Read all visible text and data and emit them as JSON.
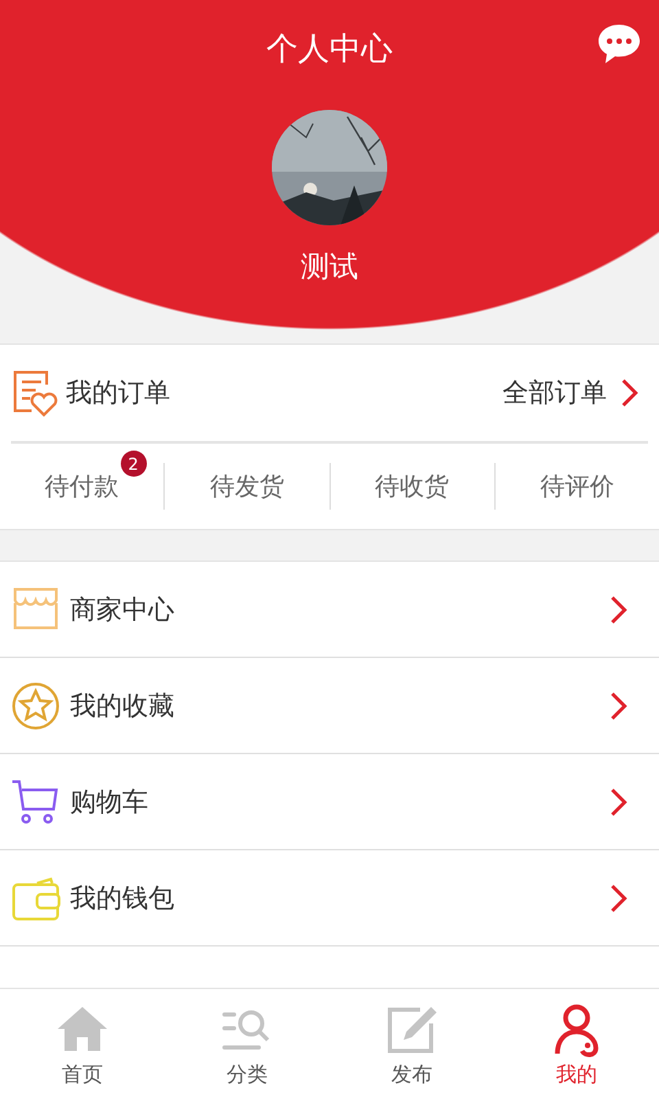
{
  "header": {
    "title": "个人中心",
    "username": "测试"
  },
  "orders": {
    "title": "我的订单",
    "all_link": "全部订单",
    "statuses": [
      {
        "label": "待付款",
        "badge": "2"
      },
      {
        "label": "待发货"
      },
      {
        "label": "待收货"
      },
      {
        "label": "待评价"
      }
    ]
  },
  "menu": [
    {
      "kind": "shop",
      "label": "商家中心"
    },
    {
      "kind": "star",
      "label": "我的收藏"
    },
    {
      "kind": "cart",
      "label": "购物车"
    },
    {
      "kind": "wallet",
      "label": "我的钱包"
    }
  ],
  "tab_bar": [
    {
      "kind": "home",
      "label": "首页",
      "selected": false
    },
    {
      "kind": "category",
      "label": "分类",
      "selected": false
    },
    {
      "kind": "post",
      "label": "发布",
      "selected": false
    },
    {
      "kind": "me",
      "label": "我的",
      "selected": true
    }
  ]
}
